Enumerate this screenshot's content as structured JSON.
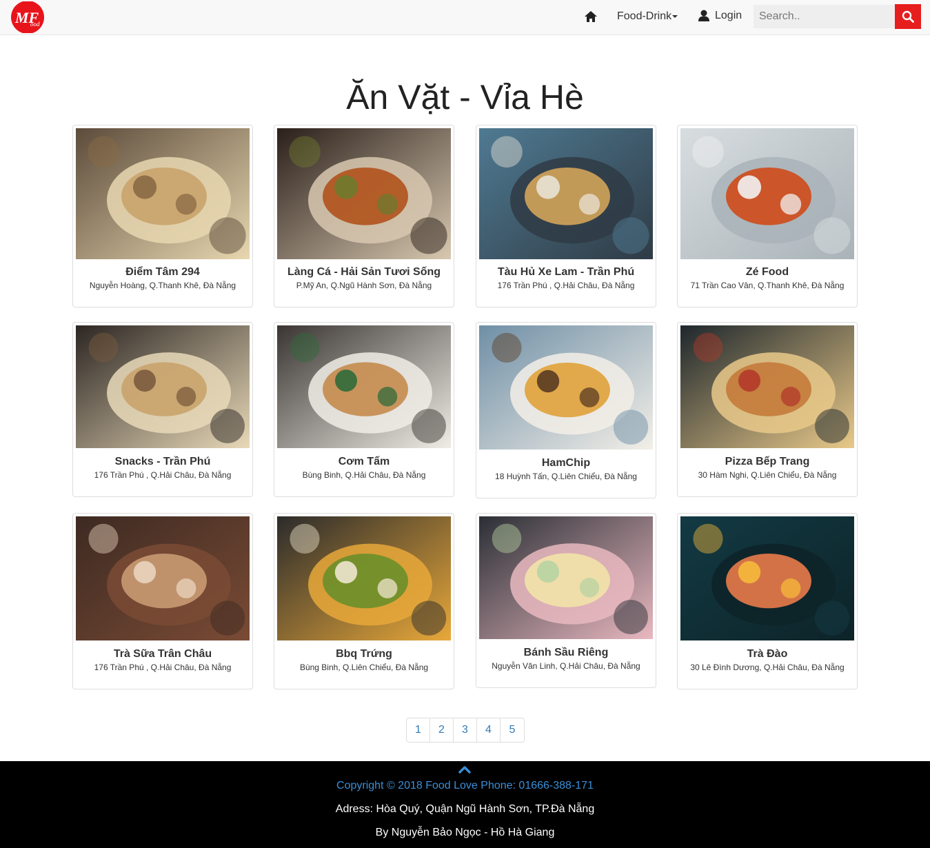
{
  "navbar": {
    "logo_icon": "mfood-logo",
    "home_icon": "home-icon",
    "food_drink_label": "Food-Drink",
    "login_label": "Login",
    "search_placeholder": "Search..",
    "search_icon": "search-icon"
  },
  "page": {
    "title": "Ăn Vặt - Vỉa Hè"
  },
  "places": [
    {
      "name": "Điểm Tâm 294",
      "address": "Nguyễn Hoàng, Q.Thanh Khê, Đà Nẵng",
      "image": "fries-on-table",
      "colors": [
        "#5c4b3a",
        "#c9a36b",
        "#8a6a45",
        "#e8d7b0"
      ]
    },
    {
      "name": "Làng Cá - Hải Sản Tươi Sống",
      "address": "P.Mỹ An, Q.Ngũ Hành Sơn, Đà Nẵng",
      "image": "grilled-crab-plate",
      "colors": [
        "#2a1f1a",
        "#b0521c",
        "#6e7a2e",
        "#d8c8b0"
      ]
    },
    {
      "name": "Tàu Hủ Xe Lam - Trần Phú",
      "address": "176 Trần Phú , Q.Hải Châu, Đà Nẵng",
      "image": "tofu-dessert-bowls",
      "colors": [
        "#4f7a92",
        "#d3a45a",
        "#e9e2d6",
        "#2f3b45"
      ]
    },
    {
      "name": "Zé Food",
      "address": "71 Trần Cao Vân, Q.Thanh Khê, Đà Nẵng",
      "image": "octopus-plate",
      "colors": [
        "#d8dde0",
        "#cf4a1a",
        "#f2f2f2",
        "#a9b3b8"
      ]
    },
    {
      "name": "Snacks - Trần Phú",
      "address": "176 Trần Phú , Q.Hải Châu, Đà Nẵng",
      "image": "snack-platter",
      "colors": [
        "#2c2623",
        "#c9a36b",
        "#7b5c3e",
        "#e8d9b8"
      ]
    },
    {
      "name": "Cơm Tấm",
      "address": "Bùng Binh, Q.Hải Châu, Đà Nẵng",
      "image": "rice-and-vegetables",
      "colors": [
        "#3a3532",
        "#c58b4e",
        "#2f6b3a",
        "#f0ede6"
      ]
    },
    {
      "name": "HamChip",
      "address": "18 Huỳnh Tấn, Q.Liên Chiểu, Đà Nẵng",
      "image": "burger-and-fries",
      "colors": [
        "#6f8fa6",
        "#e0a23a",
        "#5a3b22",
        "#f3efe8"
      ]
    },
    {
      "name": "Pizza Bếp Trang",
      "address": "30 Hàm Nghi, Q.Liên Chiểu, Đà Nẵng",
      "image": "sliced-pizza",
      "colors": [
        "#1e272c",
        "#c47a3a",
        "#b23a2a",
        "#e9c98a"
      ]
    },
    {
      "name": "Trà Sữa Trân Châu",
      "address": "176 Trần Phú , Q.Hải Châu, Đà Nẵng",
      "image": "milk-tea-cups",
      "colors": [
        "#3d2a22",
        "#c99a72",
        "#e9d4bf",
        "#7a4b35"
      ]
    },
    {
      "name": "Bbq Trứng",
      "address": "Bùng Binh, Q.Liên Chiểu, Đà Nẵng",
      "image": "avocado-egg-toast",
      "colors": [
        "#2b2b2b",
        "#6a8f2a",
        "#f0e6cf",
        "#e8a83a"
      ]
    },
    {
      "name": "Bánh Sầu Riêng",
      "address": "Nguyễn Văn Linh, Q.Hải Châu, Đà Nẵng",
      "image": "durian-cakes",
      "colors": [
        "#2a2f35",
        "#f2e3a8",
        "#b7d3a2",
        "#e9b8c0"
      ]
    },
    {
      "name": "Trà Đào",
      "address": "30 Lê Đình Dương, Q.Hải Châu, Đà Nẵng",
      "image": "peach-tea-jar",
      "colors": [
        "#133a44",
        "#e97b4a",
        "#f5b93a",
        "#0d2328"
      ]
    }
  ],
  "pagination": [
    "1",
    "2",
    "3",
    "4",
    "5"
  ],
  "footer": {
    "back_to_top_icon": "chevron-up-icon",
    "copyright": "Copyright © 2018 Food Love Phone: 01666-388-171",
    "address": "Adress: Hòa Quý, Quận Ngũ Hành Sơn, TP.Đà Nẵng",
    "authors": "By Nguyễn Bảo Ngọc - Hồ Hà Giang"
  }
}
